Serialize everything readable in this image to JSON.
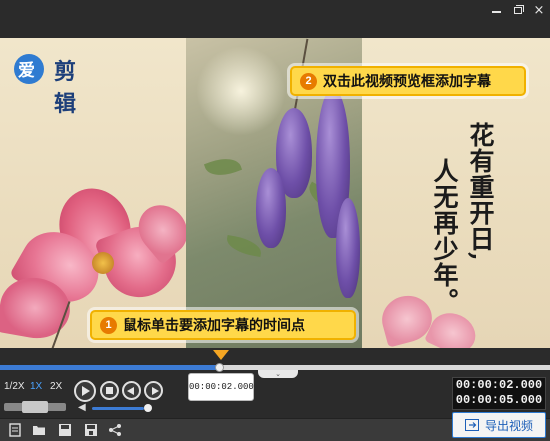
{
  "window": {
    "minimize_icon": "minimize-icon",
    "maximize_icon": "restore-icon",
    "close_label": "×"
  },
  "preview": {
    "logo_part1": "爱",
    "logo_part2": "剪辑",
    "poem_line1": "花有重开日,",
    "poem_line2": "人无再少年。"
  },
  "callouts": {
    "step1_number": "1",
    "step1_text": "鼠标单击要添加字幕的时间点",
    "step2_number": "2",
    "step2_text": "双击此视频预览框添加字幕"
  },
  "timeline": {
    "tooltip_time": "00:00:02.000",
    "progress_fraction": 0.4
  },
  "controls": {
    "speed_half": "1/2X",
    "speed_1x": "1X",
    "speed_2x": "2X",
    "current_time": "00:00:02.000",
    "total_time": "00:00:05.000",
    "volume_fraction": 0.9
  },
  "toolbar": {
    "export_label": "导出视频"
  },
  "colors": {
    "accent_blue": "#3c7bd4",
    "playhead_orange": "#f5a623",
    "callout_yellow": "#ffd84a"
  }
}
